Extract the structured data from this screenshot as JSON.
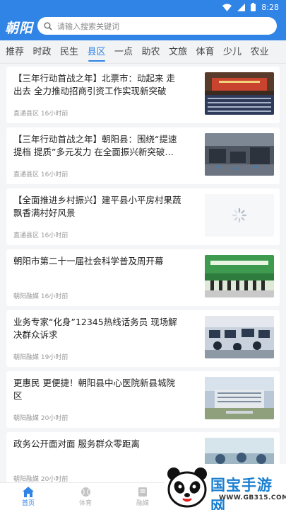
{
  "status": {
    "time": "8:28"
  },
  "header": {
    "logo": "朝阳",
    "search_placeholder": "请输入搜索关键词"
  },
  "tabs": [
    "推荐",
    "时政",
    "民生",
    "县区",
    "一点",
    "助农",
    "文旅",
    "体育",
    "少儿",
    "农业"
  ],
  "active_tab": "县区",
  "news": [
    {
      "title": "【三年行动首战之年】北票市：动起来 走出去 全力推动招商引资工作实现新突破",
      "source": "直通县区",
      "time": "16小时前",
      "thumb": "conference-hall"
    },
    {
      "title": "【三年行动首战之年】朝阳县：围绕“提速提档 提质”多元发力 在全面振兴新突破…",
      "source": "直通县区",
      "time": "16小时前",
      "thumb": "factory"
    },
    {
      "title": "【全面推进乡村振兴】建平县小平房村果蔬飘香满村好风景",
      "source": "直通县区",
      "time": "16小时前",
      "thumb": "loading"
    },
    {
      "title": "朝阳市第二十一届社会科学普及周开幕",
      "source": "朝阳融媒",
      "time": "16小时前",
      "thumb": "ceremony"
    },
    {
      "title": "业务专家“化身”12345热线话务员 现场解决群众诉求",
      "source": "朝阳融媒",
      "time": "19小时前",
      "thumb": "call-center"
    },
    {
      "title": "更惠民 更便捷！朝阳县中心医院新县城院区",
      "source": "朝阳融媒",
      "time": "20小时前",
      "thumb": "hospital"
    },
    {
      "title": "政务公开面对面 服务群众零距离",
      "source": "朝阳融媒",
      "time": "20小时前",
      "thumb": "outdoor-event"
    }
  ],
  "bottom_nav": [
    {
      "label": "首页",
      "icon": "home-icon",
      "active": true
    },
    {
      "label": "体育",
      "icon": "ball-icon",
      "active": false
    },
    {
      "label": "融媒",
      "icon": "media-icon",
      "active": false
    }
  ],
  "watermark": {
    "text": "国宝手游网",
    "url": "WWW.GB315.COM"
  },
  "colors": {
    "accent": "#2f84e6",
    "watermark": "#1a7fd1"
  }
}
